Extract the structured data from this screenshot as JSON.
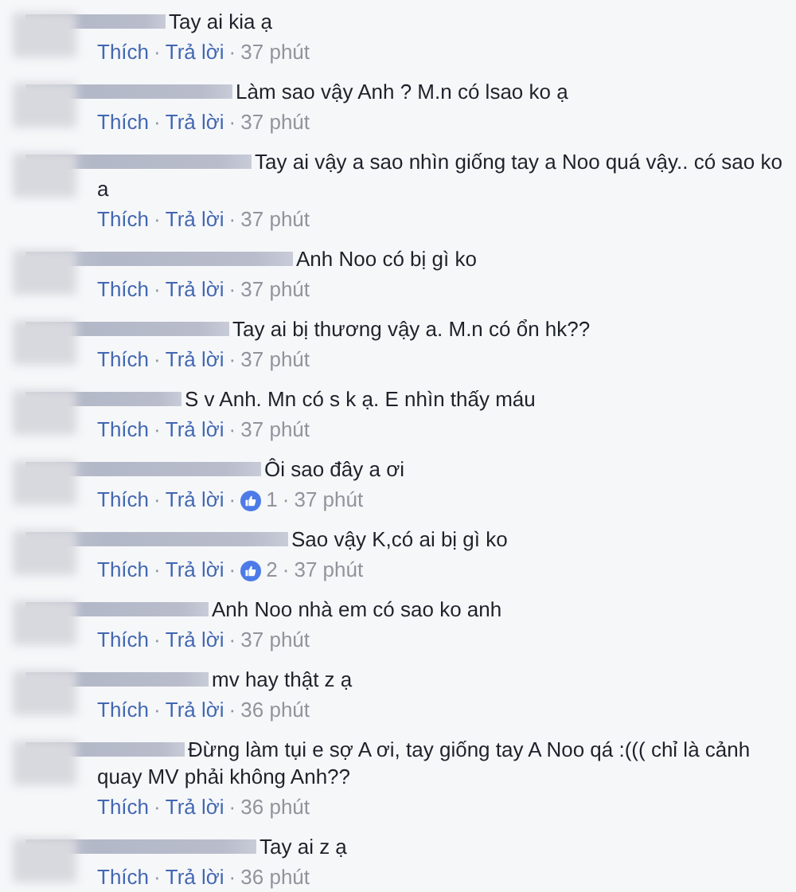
{
  "comments": [
    {
      "text": "Tay ai kia ạ",
      "actions": [
        {
          "kind": "link",
          "text": "Thích"
        },
        {
          "kind": "sep",
          "text": "·"
        },
        {
          "kind": "link",
          "text": "Trả lời"
        },
        {
          "kind": "sep",
          "text": "·"
        },
        {
          "kind": "time",
          "text": "37 phút"
        }
      ]
    },
    {
      "text": "Làm sao vậy Anh ? M.n có lsao ko ạ",
      "actions": [
        {
          "kind": "link",
          "text": "Thích"
        },
        {
          "kind": "sep",
          "text": "·"
        },
        {
          "kind": "link",
          "text": "Trả lời"
        },
        {
          "kind": "sep",
          "text": "·"
        },
        {
          "kind": "time",
          "text": "37 phút"
        }
      ]
    },
    {
      "text": "Tay ai vậy a sao nhìn giống tay a Noo quá vậy.. có sao ko a",
      "actions": [
        {
          "kind": "link",
          "text": "Thích"
        },
        {
          "kind": "sep",
          "text": "·"
        },
        {
          "kind": "link",
          "text": "Trả lời"
        },
        {
          "kind": "sep",
          "text": "·"
        },
        {
          "kind": "time",
          "text": "37 phút"
        }
      ]
    },
    {
      "text": "Anh Noo có bị gì ko",
      "actions": [
        {
          "kind": "link",
          "text": "Thích"
        },
        {
          "kind": "sep",
          "text": "·"
        },
        {
          "kind": "link",
          "text": "Trả lời"
        },
        {
          "kind": "sep",
          "text": "·"
        },
        {
          "kind": "time",
          "text": "37 phút"
        }
      ]
    },
    {
      "text": "Tay ai bị thương vậy a. M.n có ổn hk??",
      "actions": [
        {
          "kind": "link",
          "text": "Thích"
        },
        {
          "kind": "sep",
          "text": "·"
        },
        {
          "kind": "link",
          "text": "Trả lời"
        },
        {
          "kind": "sep",
          "text": "·"
        },
        {
          "kind": "time",
          "text": "37 phút"
        }
      ]
    },
    {
      "text": "S v Anh. Mn có s k ạ. E nhìn thấy máu",
      "actions": [
        {
          "kind": "link",
          "text": "Thích"
        },
        {
          "kind": "sep",
          "text": "·"
        },
        {
          "kind": "link",
          "text": "Trả lời"
        },
        {
          "kind": "sep",
          "text": "·"
        },
        {
          "kind": "time",
          "text": "37 phút"
        }
      ]
    },
    {
      "text": "Ôi sao đây a ơi",
      "actions": [
        {
          "kind": "link",
          "text": "Thích"
        },
        {
          "kind": "sep",
          "text": "·"
        },
        {
          "kind": "link",
          "text": "Trả lời"
        },
        {
          "kind": "sep",
          "text": "·"
        },
        {
          "kind": "likes",
          "text": "1"
        },
        {
          "kind": "sep",
          "text": "·"
        },
        {
          "kind": "time",
          "text": "37 phút"
        }
      ]
    },
    {
      "text": "Sao vậy K,có ai bị gì ko",
      "actions": [
        {
          "kind": "link",
          "text": "Thích"
        },
        {
          "kind": "sep",
          "text": "·"
        },
        {
          "kind": "link",
          "text": "Trả lời"
        },
        {
          "kind": "sep",
          "text": "·"
        },
        {
          "kind": "likes",
          "text": "2"
        },
        {
          "kind": "sep",
          "text": "·"
        },
        {
          "kind": "time",
          "text": "37 phút"
        }
      ]
    },
    {
      "text": "Anh Noo nhà em có sao ko anh",
      "actions": [
        {
          "kind": "link",
          "text": "Thích"
        },
        {
          "kind": "sep",
          "text": "·"
        },
        {
          "kind": "link",
          "text": "Trả lời"
        },
        {
          "kind": "sep",
          "text": "·"
        },
        {
          "kind": "time",
          "text": "37 phút"
        }
      ]
    },
    {
      "text": "mv hay thật z ạ",
      "actions": [
        {
          "kind": "link",
          "text": "Thích"
        },
        {
          "kind": "sep",
          "text": "·"
        },
        {
          "kind": "link",
          "text": "Trả lời"
        },
        {
          "kind": "sep",
          "text": "·"
        },
        {
          "kind": "time",
          "text": "36 phút"
        }
      ]
    },
    {
      "text": "Đừng làm tụi e sợ A ơi, tay giống tay A Noo qá :((( chỉ là cảnh quay MV phải không Anh??",
      "actions": [
        {
          "kind": "link",
          "text": "Thích"
        },
        {
          "kind": "sep",
          "text": "·"
        },
        {
          "kind": "link",
          "text": "Trả lời"
        },
        {
          "kind": "sep",
          "text": "·"
        },
        {
          "kind": "time",
          "text": "36 phút"
        }
      ]
    },
    {
      "text": "Tay ai z ạ",
      "actions": [
        {
          "kind": "link",
          "text": "Thích"
        },
        {
          "kind": "sep",
          "text": "·"
        },
        {
          "kind": "link",
          "text": "Trả lời"
        },
        {
          "kind": "sep",
          "text": "·"
        },
        {
          "kind": "time",
          "text": "36 phút"
        }
      ]
    }
  ]
}
